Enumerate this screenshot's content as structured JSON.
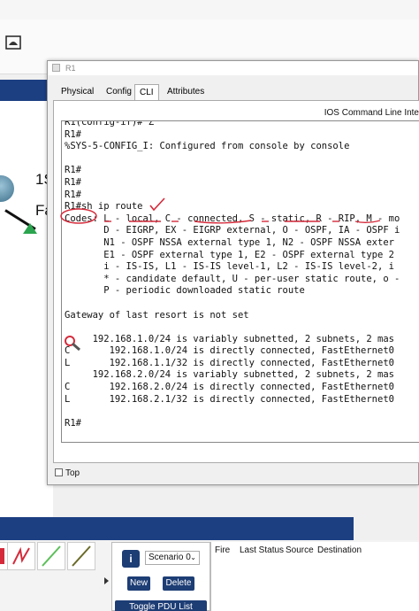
{
  "window": {
    "title": "R1",
    "tabs": [
      "Physical",
      "Config",
      "CLI",
      "Attributes"
    ],
    "active_tab": "CLI",
    "cli_heading": "IOS Command Line Inte",
    "top_checkbox_label": "Top"
  },
  "terminal": {
    "lines": [
      "R1(config-if)#^Z",
      "R1#",
      "%SYS-5-CONFIG_I: Configured from console by console",
      "",
      "R1#",
      "R1#",
      "R1#",
      "R1#sh ip route",
      "Codes: L - local, C - connected, S - static, R - RIP, M - mo",
      "       D - EIGRP, EX - EIGRP external, O - OSPF, IA - OSPF i",
      "       N1 - OSPF NSSA external type 1, N2 - OSPF NSSA exter",
      "       E1 - OSPF external type 1, E2 - OSPF external type 2",
      "       i - IS-IS, L1 - IS-IS level-1, L2 - IS-IS level-2, i",
      "       * - candidate default, U - per-user static route, o -",
      "       P - periodic downloaded static route",
      "",
      "Gateway of last resort is not set",
      "",
      "     192.168.1.0/24 is variably subnetted, 2 subnets, 2 mas",
      "C       192.168.1.0/24 is directly connected, FastEthernet0",
      "L       192.168.1.1/32 is directly connected, FastEthernet0",
      "     192.168.2.0/24 is variably subnetted, 2 subnets, 2 mas",
      "C       192.168.2.0/24 is directly connected, FastEthernet0",
      "L       192.168.2.1/32 is directly connected, FastEthernet0",
      "",
      "R1#"
    ]
  },
  "background": {
    "label_1": "1S",
    "label_2": "Fa"
  },
  "bottom": {
    "scenario_select": "Scenario 0",
    "new_button": "New",
    "delete_button": "Delete",
    "toggle_button": "Toggle PDU List Window",
    "info_icon": "i",
    "columns": [
      "Fire",
      "Last Status",
      "Source",
      "Destination"
    ]
  },
  "colors": {
    "annotation_red": "#d42a3a",
    "toolbar_blue": "#1c3f82",
    "router_green": "#2aa44f"
  },
  "icons": [
    "workspace-logo-icon",
    "router-icon",
    "magnifier-cursor-icon",
    "info-icon",
    "chevron-down-icon"
  ]
}
